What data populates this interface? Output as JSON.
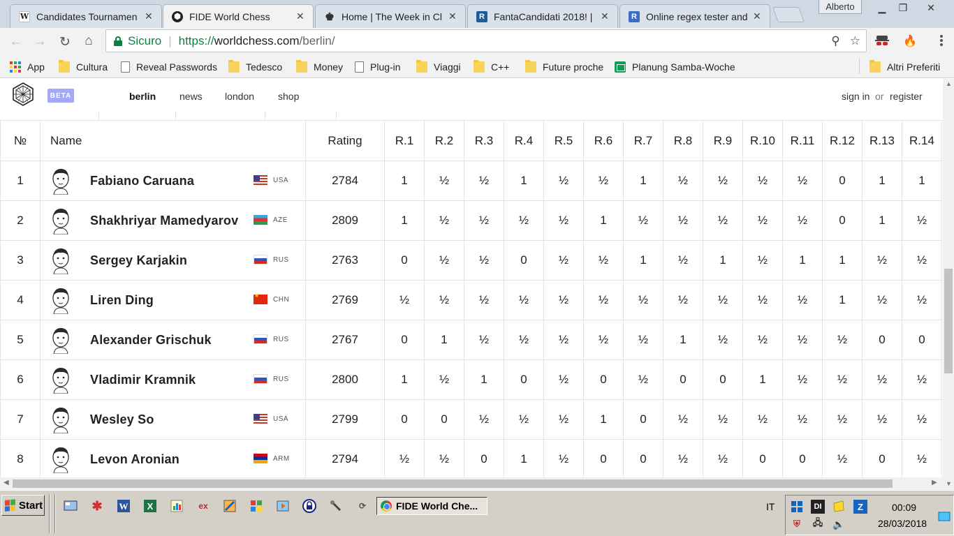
{
  "browser": {
    "tabs": [
      {
        "label": "Candidates Tournamen",
        "icon": "wikipedia-icon",
        "active": false
      },
      {
        "label": "FIDE World Chess",
        "icon": "worldchess-icon",
        "active": true
      },
      {
        "label": "Home | The Week in Cl",
        "icon": "chess-king-icon",
        "active": false
      },
      {
        "label": "FantaCandidati 2018! |",
        "icon": "fantacandidati-icon",
        "active": false
      },
      {
        "label": "Online regex tester and",
        "icon": "regex-icon",
        "active": false
      }
    ],
    "user": "Alberto",
    "secure_label": "Sicuro",
    "url_scheme": "https://",
    "url_host": "worldchess.com",
    "url_path": "/berlin/",
    "bookmarks": [
      {
        "label": "App",
        "type": "apps"
      },
      {
        "label": "Cultura",
        "type": "folder"
      },
      {
        "label": "Reveal Passwords",
        "type": "page"
      },
      {
        "label": "Tedesco",
        "type": "folder"
      },
      {
        "label": "Money",
        "type": "folder"
      },
      {
        "label": "Plug-in",
        "type": "page"
      },
      {
        "label": "Viaggi",
        "type": "folder"
      },
      {
        "label": "C++",
        "type": "folder"
      },
      {
        "label": "Future proche",
        "type": "folder"
      },
      {
        "label": "Planung Samba-Woche",
        "type": "sheets"
      }
    ],
    "other_bookmarks": "Altri Preferiti"
  },
  "site": {
    "beta": "BETA",
    "nav": [
      "berlin",
      "news",
      "london",
      "shop"
    ],
    "current_nav": "berlin",
    "sign_in": "sign in",
    "or": "or",
    "register": "register"
  },
  "standings": {
    "headers": {
      "num": "№",
      "name": "Name",
      "rating": "Rating"
    },
    "rounds": [
      "R.1",
      "R.2",
      "R.3",
      "R.4",
      "R.5",
      "R.6",
      "R.7",
      "R.8",
      "R.9",
      "R.10",
      "R.11",
      "R.12",
      "R.13",
      "R.14"
    ],
    "players": [
      {
        "num": "1",
        "name": "Fabiano Caruana",
        "fed": "USA",
        "rating": "2784",
        "results": [
          "1",
          "½",
          "½",
          "1",
          "½",
          "½",
          "1",
          "½",
          "½",
          "½",
          "½",
          "0",
          "1",
          "1"
        ]
      },
      {
        "num": "2",
        "name": "Shakhriyar Mamedyarov",
        "fed": "AZE",
        "rating": "2809",
        "results": [
          "1",
          "½",
          "½",
          "½",
          "½",
          "1",
          "½",
          "½",
          "½",
          "½",
          "½",
          "0",
          "1",
          "½"
        ]
      },
      {
        "num": "3",
        "name": "Sergey Karjakin",
        "fed": "RUS",
        "rating": "2763",
        "results": [
          "0",
          "½",
          "½",
          "0",
          "½",
          "½",
          "1",
          "½",
          "1",
          "½",
          "1",
          "1",
          "½",
          "½"
        ]
      },
      {
        "num": "4",
        "name": "Liren Ding",
        "fed": "CHN",
        "rating": "2769",
        "results": [
          "½",
          "½",
          "½",
          "½",
          "½",
          "½",
          "½",
          "½",
          "½",
          "½",
          "½",
          "1",
          "½",
          "½"
        ]
      },
      {
        "num": "5",
        "name": "Alexander Grischuk",
        "fed": "RUS",
        "rating": "2767",
        "results": [
          "0",
          "1",
          "½",
          "½",
          "½",
          "½",
          "½",
          "1",
          "½",
          "½",
          "½",
          "½",
          "0",
          "0"
        ]
      },
      {
        "num": "6",
        "name": "Vladimir Kramnik",
        "fed": "RUS",
        "rating": "2800",
        "results": [
          "1",
          "½",
          "1",
          "0",
          "½",
          "0",
          "½",
          "0",
          "0",
          "1",
          "½",
          "½",
          "½",
          "½"
        ]
      },
      {
        "num": "7",
        "name": "Wesley So",
        "fed": "USA",
        "rating": "2799",
        "results": [
          "0",
          "0",
          "½",
          "½",
          "½",
          "1",
          "0",
          "½",
          "½",
          "½",
          "½",
          "½",
          "½",
          "½"
        ]
      },
      {
        "num": "8",
        "name": "Levon Aronian",
        "fed": "ARM",
        "rating": "2794",
        "results": [
          "½",
          "½",
          "0",
          "1",
          "½",
          "0",
          "0",
          "½",
          "½",
          "0",
          "0",
          "½",
          "0",
          "½"
        ]
      }
    ]
  },
  "taskbar": {
    "start": "Start",
    "active_window": "FIDE World Che...",
    "language": "IT",
    "time": "00:09",
    "date": "28/03/2018"
  }
}
